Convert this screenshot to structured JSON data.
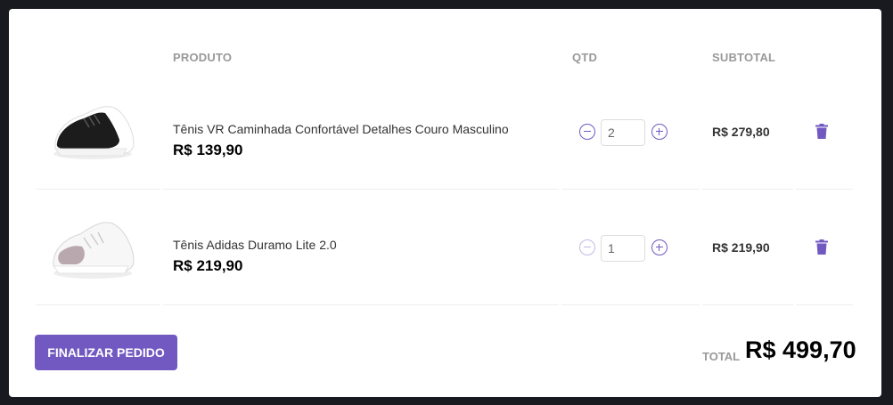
{
  "table": {
    "headers": {
      "product": "PRODUTO",
      "qty": "QTD",
      "subtotal": "SUBTOTAL"
    },
    "items": [
      {
        "title": "Tênis VR Caminhada Confortável Detalhes Couro Masculino",
        "price": "R$ 139,90",
        "quantity": "2",
        "subtotal": "R$ 279,80",
        "image_icon": "black-sneaker-image",
        "decrement_enabled": true
      },
      {
        "title": "Tênis Adidas Duramo Lite 2.0",
        "price": "R$ 219,90",
        "quantity": "1",
        "subtotal": "R$ 219,90",
        "image_icon": "white-sneaker-image",
        "decrement_enabled": false
      }
    ]
  },
  "footer": {
    "finish_label": "Finalizar pedido",
    "total_label": "TOTAL",
    "total_value": "R$ 499,70"
  },
  "colors": {
    "accent": "#7159c1",
    "accent_disabled": "#c3b8e6",
    "background": "#191920"
  }
}
